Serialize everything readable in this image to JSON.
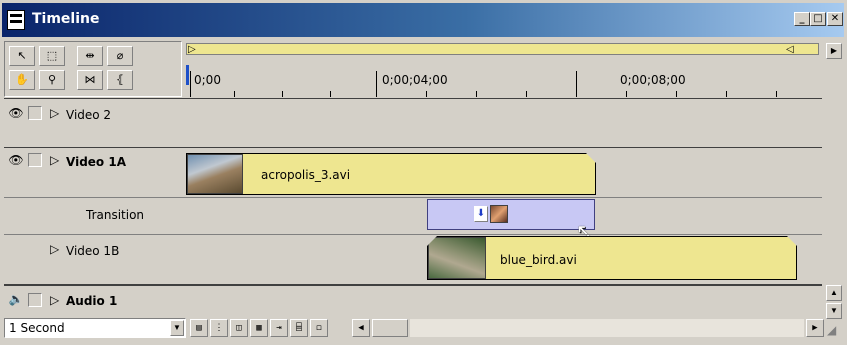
{
  "window": {
    "title": "Timeline",
    "title_icon": "timeline-window-icon",
    "controls": {
      "minimize": "_",
      "maximize": "□",
      "close": "✕"
    }
  },
  "toolbox": {
    "tools": [
      {
        "name": "selection-tool",
        "glyph": "↖"
      },
      {
        "name": "range-select-tool",
        "glyph": "⬚"
      },
      {
        "name": "track-select-tool",
        "glyph": "⇹"
      },
      {
        "name": "razor-tool",
        "glyph": "⌀"
      },
      {
        "name": "hand-tool",
        "glyph": "✋"
      },
      {
        "name": "zoom-tool",
        "glyph": "⚲"
      },
      {
        "name": "link-tool",
        "glyph": "⋈"
      },
      {
        "name": "in-out-tool",
        "glyph": "⦃"
      }
    ]
  },
  "ruler": {
    "timecodes": [
      "0;00",
      "0;00;04;00",
      "0;00;08;00"
    ]
  },
  "tracks": [
    {
      "id": "video2",
      "label": "Video 2",
      "bold": false,
      "eye": true
    },
    {
      "id": "video1a",
      "label": "Video 1A",
      "bold": true,
      "eye": true
    },
    {
      "id": "transition",
      "label": "Transition",
      "bold": false,
      "eye": false
    },
    {
      "id": "video1b",
      "label": "Video 1B",
      "bold": false,
      "eye": false
    },
    {
      "id": "audio1",
      "label": "Audio 1",
      "bold": true,
      "eye": false
    }
  ],
  "clips": {
    "acropolis": {
      "name": "acropolis_3.avi"
    },
    "blue_bird": {
      "name": "blue_bird.avi"
    }
  },
  "status": {
    "time_unit": "1 Second"
  },
  "colors": {
    "clip": "#eee690",
    "transition": "#c8c8f4",
    "title_left": "#0a246a",
    "title_right": "#a6caf0",
    "chrome": "#d4d0c8"
  }
}
